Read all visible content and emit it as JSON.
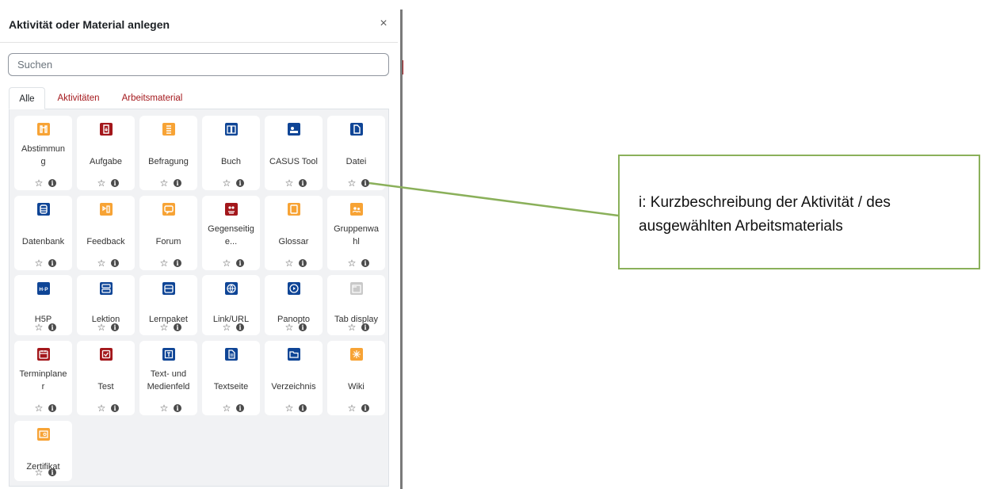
{
  "modal": {
    "title": "Aktivität oder Material anlegen",
    "close_symbol": "×"
  },
  "search": {
    "placeholder": "Suchen"
  },
  "tabs": [
    {
      "label": "Alle",
      "active": true
    },
    {
      "label": "Aktivitäten",
      "active": false
    },
    {
      "label": "Arbeitsmaterial",
      "active": false
    }
  ],
  "items": [
    {
      "label": "Abstimmun\ng",
      "icon": "choice-icon",
      "color": "#f7a335"
    },
    {
      "label": "Aufgabe",
      "icon": "assignment-icon",
      "color": "#a3171b"
    },
    {
      "label": "Befragung",
      "icon": "feedback-survey-icon",
      "color": "#f7a335"
    },
    {
      "label": "Buch",
      "icon": "book-icon",
      "color": "#0f4596"
    },
    {
      "label": "CASUS Tool",
      "icon": "casus-icon",
      "color": "#0f4596"
    },
    {
      "label": "Datei",
      "icon": "file-icon",
      "color": "#0f4596"
    },
    {
      "label": "Datenbank",
      "icon": "database-icon",
      "color": "#0f4596"
    },
    {
      "label": "Feedback",
      "icon": "feedback-icon",
      "color": "#f7a335"
    },
    {
      "label": "Forum",
      "icon": "forum-icon",
      "color": "#f7a335"
    },
    {
      "label": "Gegenseitig\ne...",
      "icon": "workshop-icon",
      "color": "#a3171b"
    },
    {
      "label": "Glossar",
      "icon": "glossary-icon",
      "color": "#f7a335"
    },
    {
      "label": "Gruppenwa\nhl",
      "icon": "group-choice-icon",
      "color": "#f7a335"
    },
    {
      "label": "H5P",
      "icon": "h5p-icon",
      "color": "#0f4596"
    },
    {
      "label": "Lektion",
      "icon": "lesson-icon",
      "color": "#0f4596"
    },
    {
      "label": "Lernpaket",
      "icon": "scorm-icon",
      "color": "#0f4596"
    },
    {
      "label": "Link/URL",
      "icon": "url-globe-icon",
      "color": "#0f4596"
    },
    {
      "label": "Panopto",
      "icon": "panopto-icon",
      "color": "#0f4596"
    },
    {
      "label": "Tab display",
      "icon": "tab-display-icon",
      "color": "#c9c9c9"
    },
    {
      "label": "Terminplane\nr",
      "icon": "scheduler-icon",
      "color": "#a3171b"
    },
    {
      "label": "Test",
      "icon": "quiz-icon",
      "color": "#a3171b"
    },
    {
      "label": "Text- und\nMedienfeld",
      "icon": "text-media-icon",
      "color": "#0f4596"
    },
    {
      "label": "Textseite",
      "icon": "page-icon",
      "color": "#0f4596"
    },
    {
      "label": "Verzeichnis",
      "icon": "folder-icon",
      "color": "#0f4596"
    },
    {
      "label": "Wiki",
      "icon": "wiki-icon",
      "color": "#f7a335"
    },
    {
      "label": "Zertifikat",
      "icon": "certificate-icon",
      "color": "#f7a335"
    }
  ],
  "item_actions": {
    "star_symbol": "☆",
    "info_symbol": "i"
  },
  "callout": {
    "text": "i: Kurzbeschreibung der Aktivität / des ausgewählten Arbeitsmaterials",
    "border_color": "#8ab05a"
  }
}
